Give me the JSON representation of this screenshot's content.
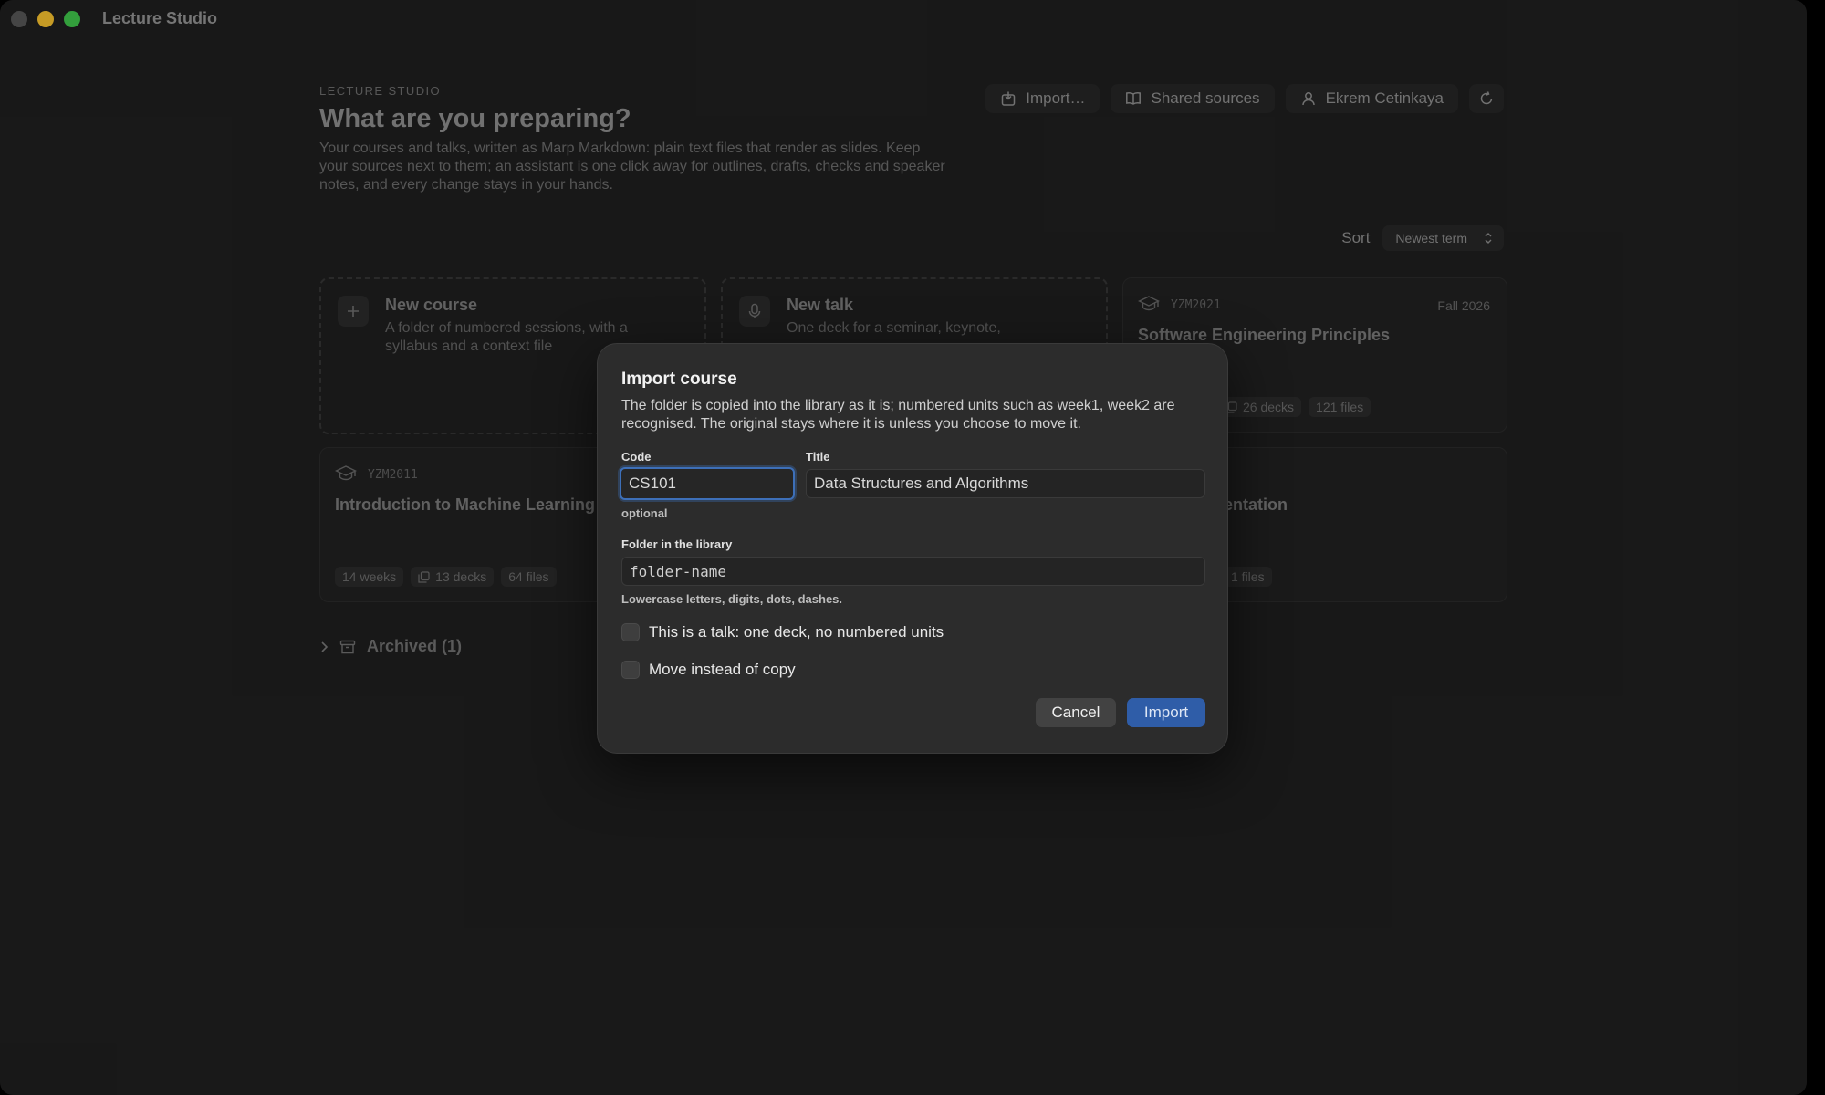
{
  "window": {
    "title": "Lecture Studio"
  },
  "header": {
    "eyebrow": "LECTURE STUDIO",
    "title": "What are you preparing?",
    "intro": "Your courses and talks, written as Marp Markdown: plain text files that render as slides. Keep your sources next to them; an assistant is one click away for outlines, drafts, checks and speaker notes, and every change stays in your hands."
  },
  "toolbar": {
    "import_label": "Import…",
    "shared_label": "Shared sources",
    "user_label": "Ekrem Cetinkaya"
  },
  "sort": {
    "label": "Sort",
    "value": "Newest term"
  },
  "cards": {
    "new_course": {
      "title": "New course",
      "desc": "A folder of numbered sessions, with a syllabus and a context file"
    },
    "new_talk": {
      "title": "New talk",
      "desc": "One deck for a seminar, keynote,"
    },
    "course1": {
      "code": "YZM2021",
      "term": "Fall 2026",
      "title": "Software Engineering Principles",
      "decks": "26 decks",
      "files": "121 files"
    },
    "course2": {
      "code": "YZM2011",
      "title": "Introduction to Machine Learning",
      "weeks": "14 weeks",
      "decks": "13 decks",
      "files": "64 files"
    },
    "card6": {
      "title_fragment": "sentation",
      "files": "1 files"
    }
  },
  "archived": {
    "label": "Archived (1)"
  },
  "dialog": {
    "title": "Import course",
    "description": "The folder is copied into the library as it is; numbered units such as week1, week2 are recognised. The original stays where it is unless you choose to move it.",
    "code": {
      "label": "Code",
      "value": "CS101",
      "hint": "optional"
    },
    "title_field": {
      "label": "Title",
      "value": "Data Structures and Algorithms"
    },
    "folder": {
      "label": "Folder in the library",
      "placeholder": "folder-name",
      "hint": "Lowercase letters, digits, dots, dashes."
    },
    "talk_checkbox": "This is a talk: one deck, no numbered units",
    "move_checkbox": "Move instead of copy",
    "cancel_label": "Cancel",
    "import_label": "Import"
  },
  "colors": {
    "accent": "#2f5da8",
    "focus": "#3d6fb8",
    "close": "#ff5f57",
    "minimize": "#febc2e",
    "zoom": "#28c840"
  }
}
